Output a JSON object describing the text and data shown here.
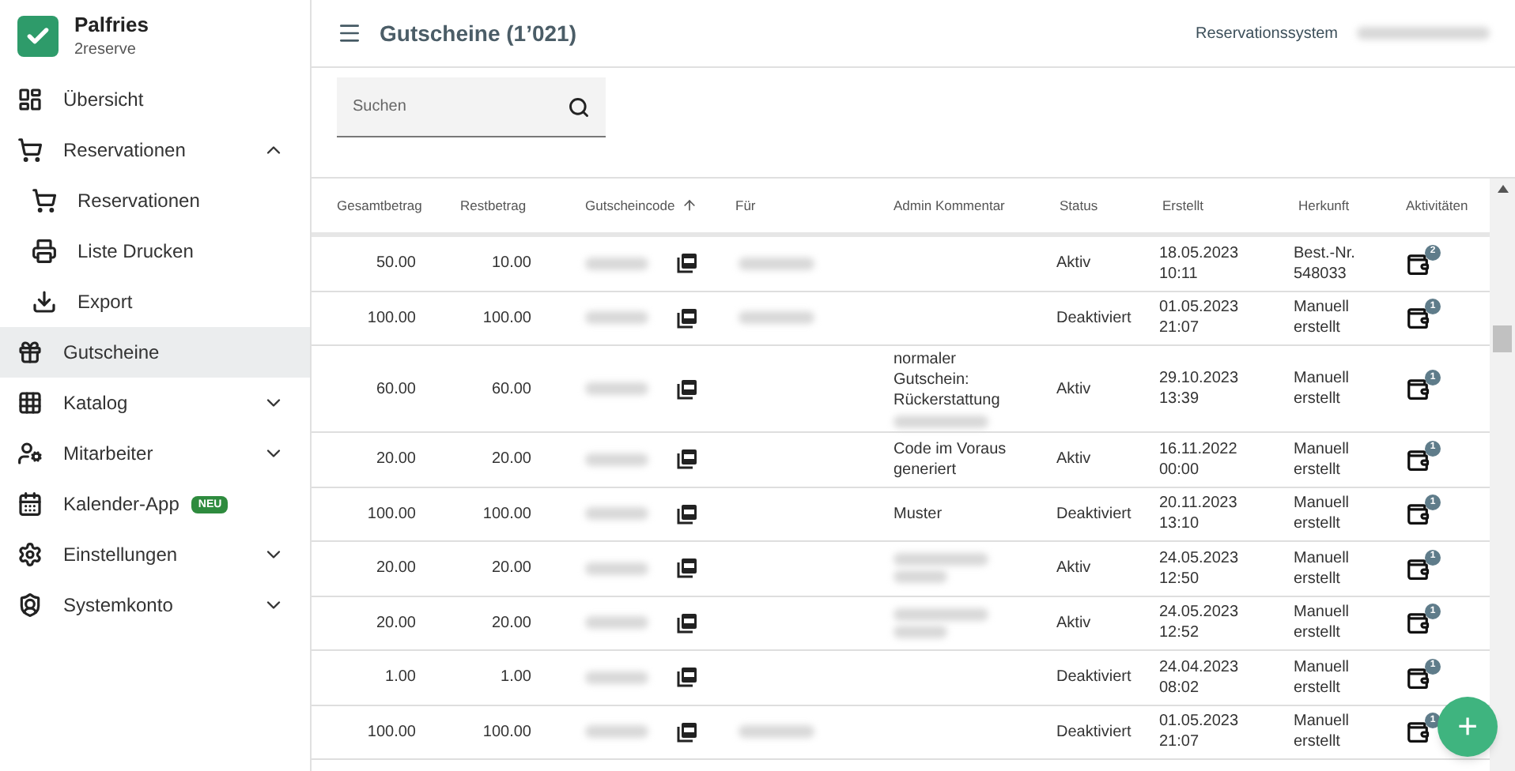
{
  "app": {
    "name": "Palfries",
    "subtitle": "2reserve"
  },
  "sidebar": {
    "items": [
      {
        "label": "Übersicht",
        "kind": "dashboard",
        "selected": false
      },
      {
        "label": "Reservationen",
        "kind": "cart",
        "selected": false,
        "expanded": true,
        "children": [
          {
            "label": "Reservationen",
            "kind": "cart",
            "selected": false
          },
          {
            "label": "Liste Drucken",
            "kind": "print",
            "selected": false
          },
          {
            "label": "Export",
            "kind": "download",
            "selected": false
          }
        ]
      },
      {
        "label": "Gutscheine",
        "kind": "gift",
        "selected": true
      },
      {
        "label": "Katalog",
        "kind": "grid",
        "selected": false,
        "expanded": false
      },
      {
        "label": "Mitarbeiter",
        "kind": "people",
        "selected": false,
        "expanded": false
      },
      {
        "label": "Kalender-App",
        "kind": "calendar",
        "selected": false,
        "badge": "NEU"
      },
      {
        "label": "Einstellungen",
        "kind": "gear",
        "selected": false,
        "expanded": false
      },
      {
        "label": "Systemkonto",
        "kind": "account",
        "selected": false,
        "expanded": false
      }
    ]
  },
  "header": {
    "title": "Gutscheine (1’021)",
    "link": "Reservationssystem",
    "user_redacted": true
  },
  "search": {
    "placeholder": "Suchen"
  },
  "table": {
    "columns": [
      {
        "label": "Gesamtbetrag"
      },
      {
        "label": "Restbetrag"
      },
      {
        "label": "Gutscheincode",
        "sorted": true
      },
      {
        "label": "Für"
      },
      {
        "label": "Admin Kommentar"
      },
      {
        "label": "Status"
      },
      {
        "label": "Erstellt"
      },
      {
        "label": "Herkunft"
      },
      {
        "label": "Aktivitäten"
      }
    ],
    "rows": [
      {
        "total": "50.00",
        "rest": "10.00",
        "code_redacted": true,
        "for_redacted": true,
        "comment": [],
        "comment_redacted": false,
        "status": "Aktiv",
        "created": [
          "18.05.2023",
          "10:11"
        ],
        "origin": [
          "Best.-Nr.",
          "548033"
        ],
        "activities": "2"
      },
      {
        "total": "100.00",
        "rest": "100.00",
        "code_redacted": true,
        "for_redacted": true,
        "comment": [],
        "comment_redacted": false,
        "status": "Deaktiviert",
        "created": [
          "01.05.2023",
          "21:07"
        ],
        "origin": [
          "Manuell",
          "erstellt"
        ],
        "activities": "1"
      },
      {
        "total": "60.00",
        "rest": "60.00",
        "code_redacted": true,
        "for_redacted": false,
        "comment": [
          "normaler",
          "Gutschein:",
          "Rückerstattung"
        ],
        "comment_redacted": true,
        "status": "Aktiv",
        "created": [
          "29.10.2023",
          "13:39"
        ],
        "origin": [
          "Manuell",
          "erstellt"
        ],
        "activities": "1"
      },
      {
        "total": "20.00",
        "rest": "20.00",
        "code_redacted": true,
        "for_redacted": false,
        "comment": [
          "Code im Voraus",
          "generiert"
        ],
        "comment_redacted": false,
        "status": "Aktiv",
        "created": [
          "16.11.2022",
          "00:00"
        ],
        "origin": [
          "Manuell",
          "erstellt"
        ],
        "activities": "1"
      },
      {
        "total": "100.00",
        "rest": "100.00",
        "code_redacted": true,
        "for_redacted": false,
        "comment": [
          "Muster"
        ],
        "comment_redacted": false,
        "status": "Deaktiviert",
        "created": [
          "20.11.2023",
          "13:10"
        ],
        "origin": [
          "Manuell",
          "erstellt"
        ],
        "activities": "1"
      },
      {
        "total": "20.00",
        "rest": "20.00",
        "code_redacted": true,
        "for_redacted": false,
        "comment": [],
        "comment_redacted": true,
        "status": "Aktiv",
        "created": [
          "24.05.2023",
          "12:50"
        ],
        "origin": [
          "Manuell",
          "erstellt"
        ],
        "activities": "1"
      },
      {
        "total": "20.00",
        "rest": "20.00",
        "code_redacted": true,
        "for_redacted": false,
        "comment": [],
        "comment_redacted": true,
        "status": "Aktiv",
        "created": [
          "24.05.2023",
          "12:52"
        ],
        "origin": [
          "Manuell",
          "erstellt"
        ],
        "activities": "1"
      },
      {
        "total": "1.00",
        "rest": "1.00",
        "code_redacted": true,
        "for_redacted": false,
        "comment": [],
        "comment_redacted": false,
        "status": "Deaktiviert",
        "created": [
          "24.04.2023",
          "08:02"
        ],
        "origin": [
          "Manuell",
          "erstellt"
        ],
        "activities": "1"
      },
      {
        "total": "100.00",
        "rest": "100.00",
        "code_redacted": true,
        "for_redacted": true,
        "comment": [],
        "comment_redacted": false,
        "status": "Deaktiviert",
        "created": [
          "01.05.2023",
          "21:07"
        ],
        "origin": [
          "Manuell",
          "erstellt"
        ],
        "activities": "1"
      }
    ]
  },
  "fab": {
    "label": "+"
  }
}
